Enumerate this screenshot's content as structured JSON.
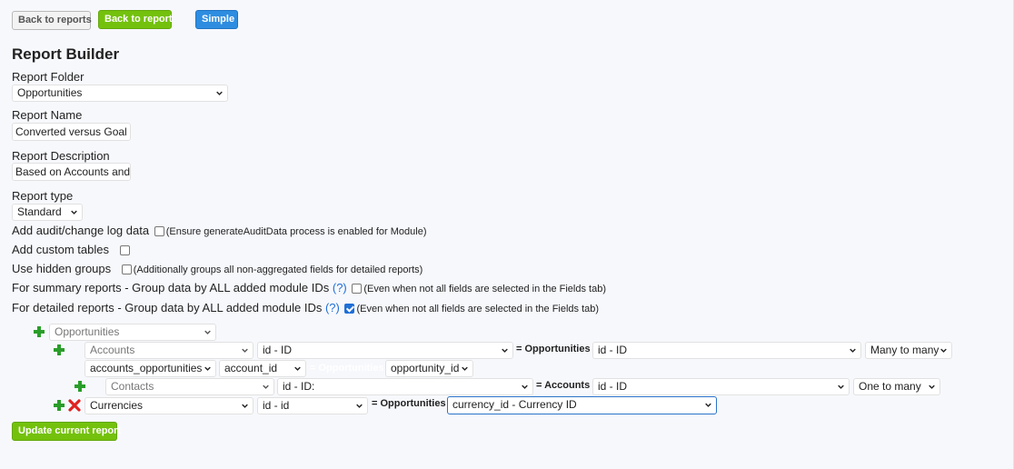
{
  "toolbar": {
    "back_to_reports": "Back to reports",
    "back_to_report": "Back to report",
    "simple": "Simple"
  },
  "page_title": "Report Builder",
  "form": {
    "folder_label": "Report Folder",
    "folder_value": "Opportunities",
    "name_label": "Report Name",
    "name_value": "Converted versus Goal I",
    "description_label": "Report Description",
    "description_value": "Based on Accounts and",
    "type_label": "Report type",
    "type_value": "Standard"
  },
  "options": {
    "audit": {
      "label": "Add audit/change log data",
      "checked": false,
      "note": "(Ensure generateAuditData process is enabled for Module)"
    },
    "custom_tables": {
      "label": "Add custom tables",
      "checked": false
    },
    "hidden_groups": {
      "label": "Use hidden groups",
      "checked": false,
      "note": "(Additionally groups all non-aggregated fields for detailed reports)"
    },
    "summary_group": {
      "label": "For summary reports - Group data by ALL added module IDs",
      "help": "(?)",
      "checked": false,
      "note": "(Even when not all fields are selected in the Fields tab)"
    },
    "detailed_group": {
      "label": "For detailed reports - Group data by ALL added module IDs",
      "help": "(?)",
      "checked": true,
      "note": "(Even when not all fields are selected in the Fields tab)"
    }
  },
  "modules": {
    "root": "Opportunities",
    "accounts": {
      "module": "Accounts",
      "field": "id - ID",
      "eq_label": "= Opportunities",
      "target_field": "id - ID",
      "relationship": "Many to many",
      "join_table": "accounts_opportunities",
      "join_left": "account_id",
      "join_eq_label": "= Opportunities",
      "join_right": "opportunity_id"
    },
    "contacts": {
      "module": "Contacts",
      "field": "id - ID:",
      "eq_label": "= Accounts",
      "target_field": "id - ID",
      "relationship": "One to many"
    },
    "currencies": {
      "module": "Currencies",
      "field": "id - id",
      "eq_label": "= Opportunities",
      "target_field": "currency_id - Currency ID"
    }
  },
  "update_button": "Update current report",
  "colors": {
    "accent_green": "#74c10d",
    "accent_blue": "#2e8de0",
    "plus_green": "#2a9d2a",
    "remove_red": "#e02020"
  }
}
